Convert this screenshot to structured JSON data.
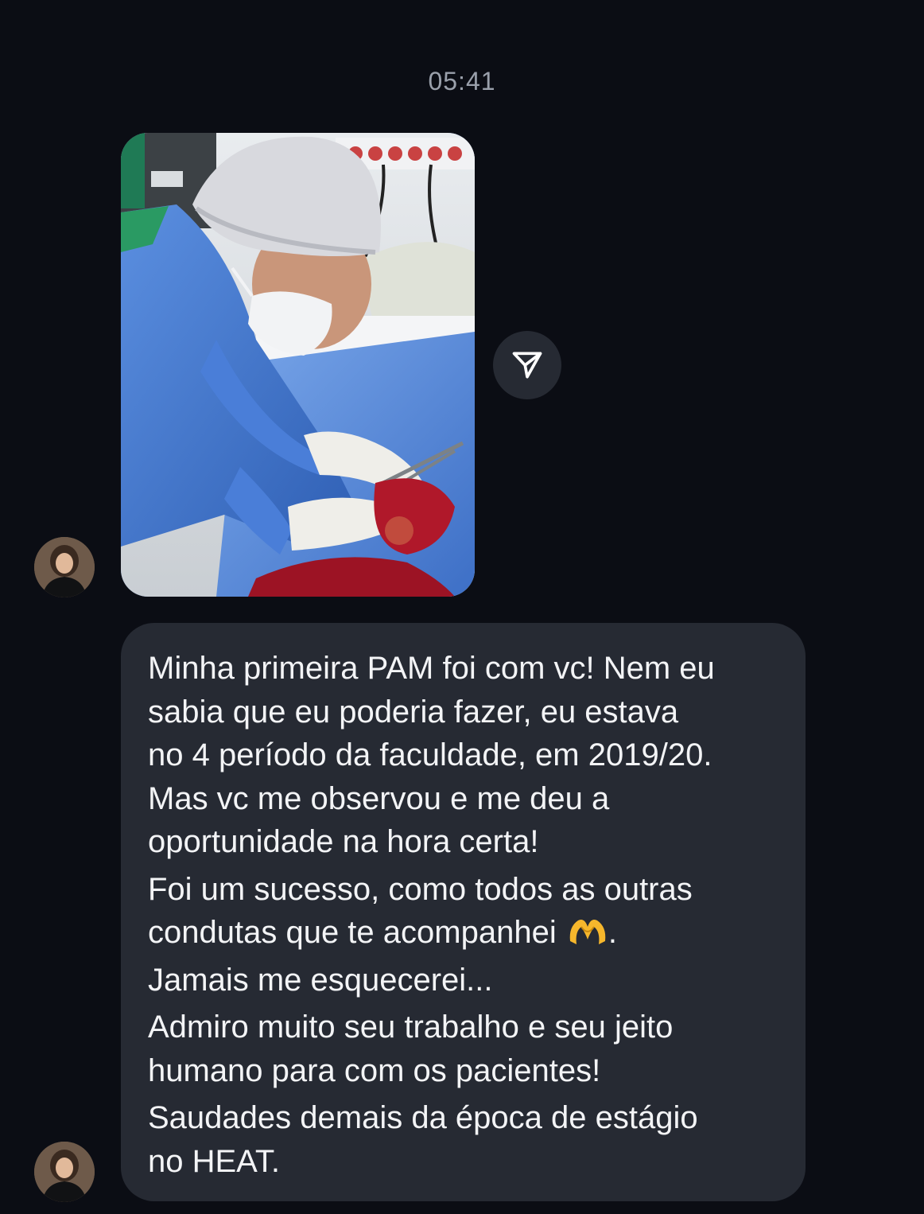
{
  "chat": {
    "timestamp": "05:41",
    "message": {
      "lines": [
        "Minha primeira PAM foi com vc! Nem eu",
        "sabia que eu poderia fazer, eu estava",
        "no 4 período da faculdade, em 2019/20.",
        "Mas vc me observou e me deu a",
        "oportunidade na hora certa!",
        "Foi um sucesso, como todos as outras",
        "condutas que te acompanhei",
        "Jamais me esquecerei...",
        "Admiro muito seu trabalho e seu jeito",
        "humano para com os pacientes!",
        "Saudades demais da época de estágio",
        "no HEAT."
      ],
      "emoji_suffix": ".",
      "emoji_icon": "heart-hands-icon"
    },
    "share_icon": "paper-plane-icon",
    "avatar_icon": "profile-avatar-icon"
  },
  "colors": {
    "background": "#0b0d14",
    "bubble": "#262a33",
    "text": "#f3f4f6",
    "timestamp": "#9aa0ab",
    "emoji": "#f6b72c"
  }
}
